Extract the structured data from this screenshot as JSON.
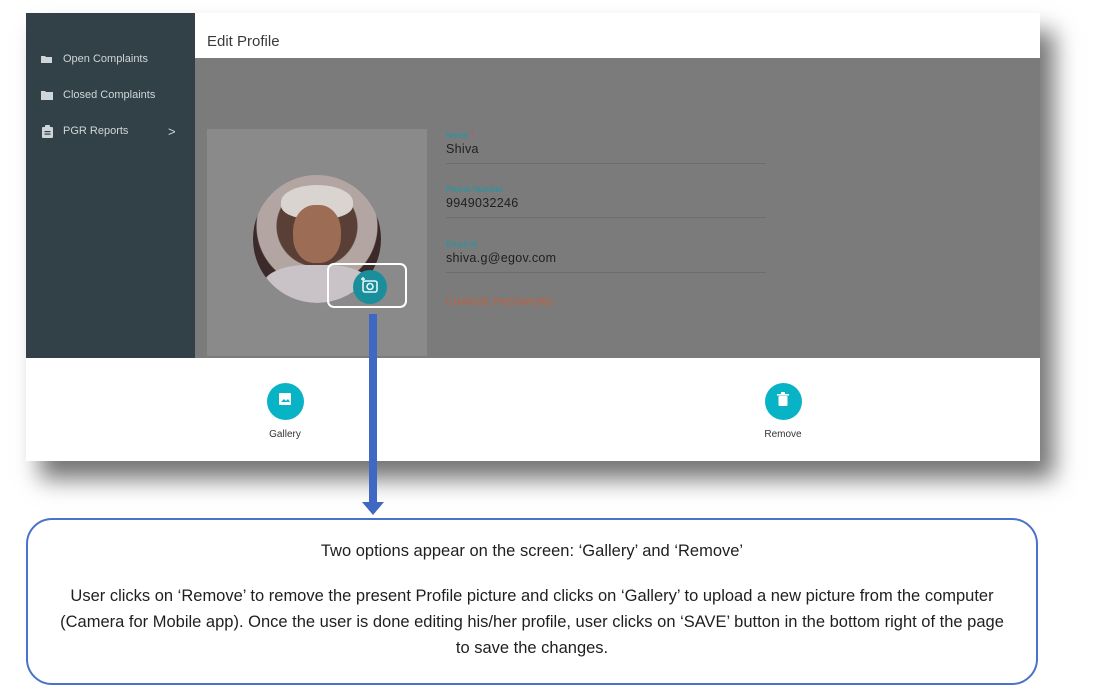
{
  "sidebar": {
    "items": [
      {
        "label": "Open Complaints",
        "icon": "folder-open-icon"
      },
      {
        "label": "Closed Complaints",
        "icon": "folder-icon"
      },
      {
        "label": "PGR Reports",
        "icon": "clipboard-icon",
        "chevron": ">"
      }
    ]
  },
  "header": {
    "title": "Edit Profile"
  },
  "profile": {
    "name_label": "Name",
    "name_required": "*",
    "name_value": "Shiva",
    "phone_label": "Phone Number",
    "phone_value": "9949032246",
    "email_label": "Email Id",
    "email_value": "shiva.g@egov.com",
    "change_password": "CHANGE PASSWORD"
  },
  "bottom_sheet": {
    "gallery_label": "Gallery",
    "remove_label": "Remove"
  },
  "callout": {
    "line1": "Two options appear on the screen: ‘Gallery’ and ‘Remove’",
    "line2": "User clicks on ‘Remove’ to remove the present Profile picture and clicks on ‘Gallery’ to upload a new picture from the computer (Camera for Mobile app). Once the user is done editing his/her profile, user clicks on ‘SAVE’ button in the bottom right of the page to save the changes."
  },
  "colors": {
    "sidebar": "#324147",
    "accent": "#09b3c6",
    "overlay": "#7b7b7b",
    "arrow": "#3e68c4",
    "change_password": "#c0603e"
  }
}
